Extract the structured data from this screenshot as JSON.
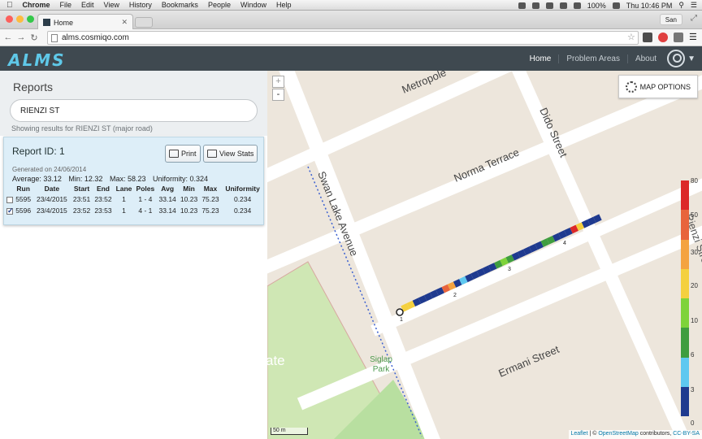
{
  "os_menubar": {
    "apple": "",
    "items": [
      "Chrome",
      "File",
      "Edit",
      "View",
      "History",
      "Bookmarks",
      "People",
      "Window",
      "Help"
    ],
    "battery": "100%",
    "clock": "Thu 10:46 PM"
  },
  "browser": {
    "tab_title": "Home",
    "profile": "San",
    "url": "alms.cosmiqo.com"
  },
  "app": {
    "logo": "ALMS",
    "nav": [
      "Home",
      "Problem Areas",
      "About"
    ],
    "active_nav": "Home"
  },
  "sidebar": {
    "title": "Reports",
    "search_value": "RIENZI ST",
    "results_note": "Showing results for RIENZI ST (major road)",
    "report": {
      "id_label": "Report ID: 1",
      "print_label": "Print",
      "view_stats_label": "View Stats",
      "generated": "Generated on 24/06/2014",
      "average": "Average: 33.12",
      "min": "Min: 12.32",
      "max": "Max: 58.23",
      "uniformity": "Uniformity: 0.324",
      "columns": [
        "Run",
        "Date",
        "Start",
        "End",
        "Lane",
        "Poles",
        "Avg",
        "Min",
        "Max",
        "Uniformity"
      ],
      "rows": [
        {
          "checked": false,
          "run": "5595",
          "date": "23/4/2015",
          "start": "23:51",
          "end": "23:52",
          "lane": "1",
          "poles": "1 - 4",
          "avg": "33.14",
          "min": "10.23",
          "max": "75.23",
          "uniformity": "0.234"
        },
        {
          "checked": true,
          "run": "5596",
          "date": "23/4/2015",
          "start": "23:52",
          "end": "23:53",
          "lane": "1",
          "poles": "4 - 1",
          "avg": "33.14",
          "min": "10.23",
          "max": "75.23",
          "uniformity": "0.234"
        }
      ]
    }
  },
  "map": {
    "zoom_in": "+",
    "zoom_out": "-",
    "options_label": "MAP OPTIONS",
    "streets": [
      "Metropole",
      "Dido Street",
      "Norma Terrace",
      "Swan Lake Avenue",
      "Ermani Street",
      "Rienzi Street"
    ],
    "park_label": "Siglap\nPark",
    "partial_label": "ate",
    "poles": [
      "1",
      "2",
      "3",
      "4"
    ],
    "scale": "50 m",
    "attribution": {
      "leaflet": "Leaflet",
      "sep": " | © ",
      "osm": "OpenStreetMap",
      "contrib": " contributors, ",
      "license": "CC-BY-SA"
    },
    "legend": {
      "ticks": [
        "80",
        "50",
        "30",
        "20",
        "10",
        "6",
        "3",
        "0"
      ],
      "colors": [
        "#1f3a8f",
        "#5ec8f0",
        "#3f9d3f",
        "#7ed33a",
        "#f4d03f",
        "#f4a340",
        "#e8643c",
        "#dc2828"
      ]
    }
  }
}
